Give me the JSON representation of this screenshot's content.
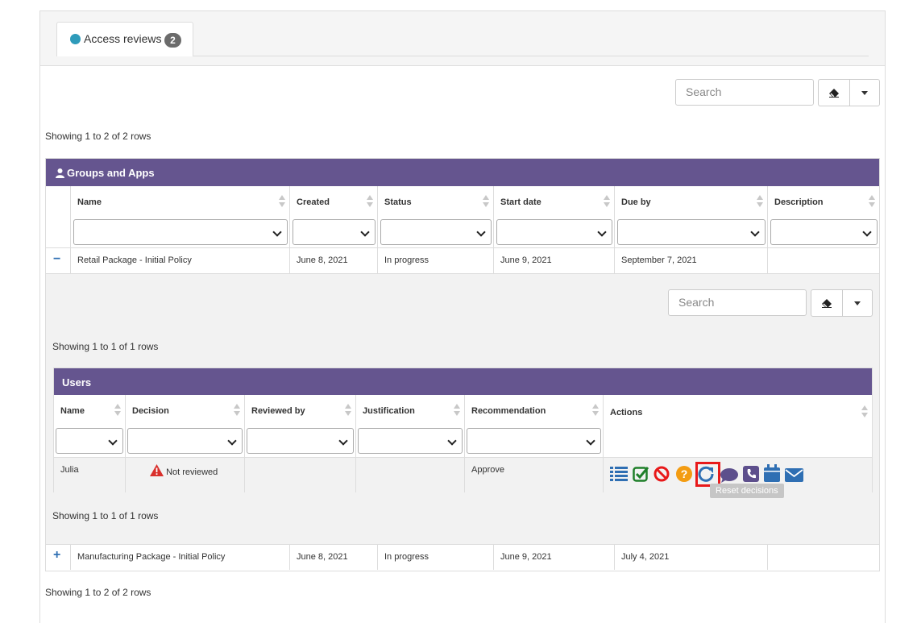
{
  "tab": {
    "label": "Access reviews",
    "badge": "2"
  },
  "toolbar": {
    "search_placeholder": "Search"
  },
  "showing_top": "Showing 1 to 2 of 2 rows",
  "showing_bottom": "Showing 1 to 2 of 2 rows",
  "groups": {
    "title": "Groups and Apps",
    "columns": [
      "Name",
      "Created",
      "Status",
      "Start date",
      "Due by",
      "Description"
    ],
    "rows": [
      {
        "toggle": "−",
        "name": "Retail Package - Initial Policy",
        "created": "June 8, 2021",
        "status": "In progress",
        "start": "June 9, 2021",
        "due": "September 7, 2021",
        "description": ""
      },
      {
        "toggle": "+",
        "name": "Manufacturing Package - Initial Policy",
        "created": "June 8, 2021",
        "status": "In progress",
        "start": "June 9, 2021",
        "due": "July 4, 2021",
        "description": ""
      }
    ]
  },
  "detail": {
    "search_placeholder": "Search",
    "showing_top": "Showing 1 to 1 of 1 rows",
    "showing_bottom": "Showing 1 to 1 of 1 rows",
    "users": {
      "title": "Users",
      "columns": [
        "Name",
        "Decision",
        "Reviewed by",
        "Justification",
        "Recommendation",
        "Actions"
      ],
      "row": {
        "name": "Julia",
        "decision": "Not reviewed",
        "reviewed_by": "",
        "justification": "",
        "recommendation": "Approve"
      },
      "actions": [
        "list-icon",
        "approve-check-icon",
        "deny-icon",
        "question-icon",
        "reset-icon",
        "comment-icon",
        "phone-icon",
        "calendar-icon",
        "email-icon"
      ],
      "tooltip": "Reset decisions"
    }
  },
  "colors": {
    "header": "#65558f",
    "accent": "#2e9bba",
    "highlight": "#e8191a"
  }
}
